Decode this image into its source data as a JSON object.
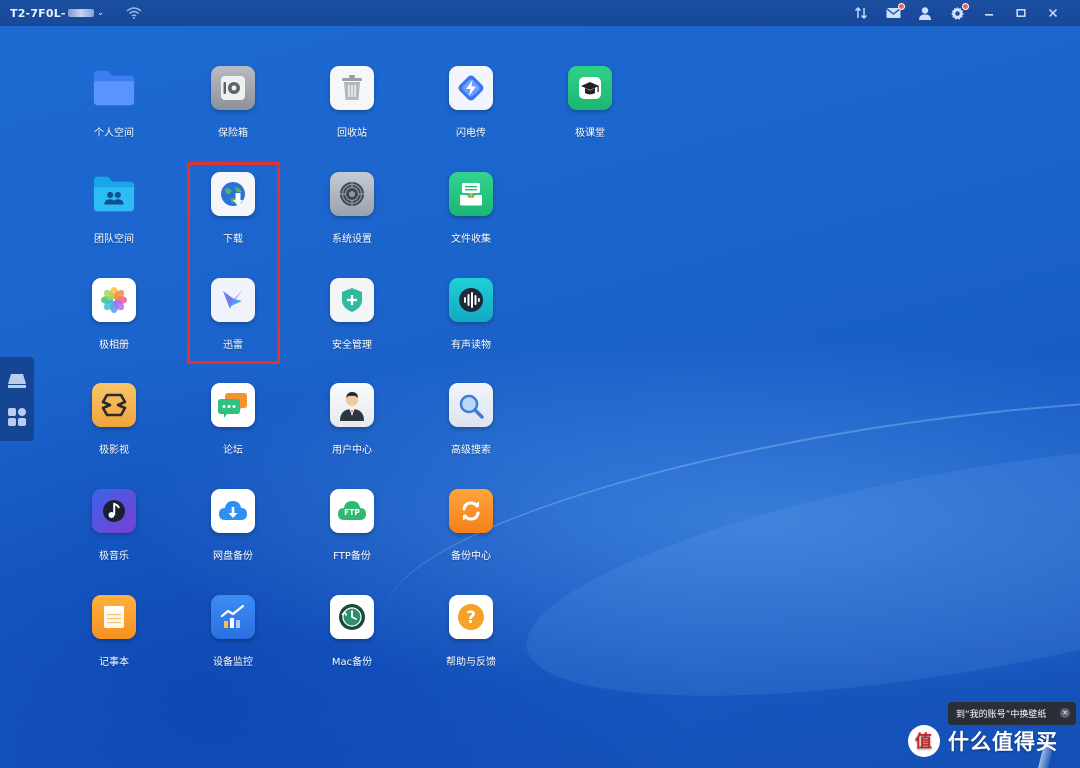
{
  "topbar": {
    "device_name": "T2-7F0L-",
    "icons": [
      "wifi-icon",
      "transfer-icon",
      "message-icon",
      "user-icon",
      "settings-icon",
      "minimize-icon",
      "maximize-icon",
      "close-icon"
    ]
  },
  "apps": [
    {
      "id": "personal-space",
      "label": "个人空间"
    },
    {
      "id": "safe-box",
      "label": "保险箱"
    },
    {
      "id": "recycle-bin",
      "label": "回收站"
    },
    {
      "id": "flash-transfer",
      "label": "闪电传"
    },
    {
      "id": "ji-course",
      "label": "极课堂"
    },
    {
      "id": "team-space",
      "label": "团队空间"
    },
    {
      "id": "download",
      "label": "下载"
    },
    {
      "id": "system-settings",
      "label": "系统设置"
    },
    {
      "id": "file-collect",
      "label": "文件收集"
    },
    {
      "id": "photo-album",
      "label": "极相册"
    },
    {
      "id": "xunlei",
      "label": "迅雷"
    },
    {
      "id": "security-management",
      "label": "安全管理"
    },
    {
      "id": "audiobook",
      "label": "有声读物"
    },
    {
      "id": "ji-video",
      "label": "极影视"
    },
    {
      "id": "forum",
      "label": "论坛"
    },
    {
      "id": "user-center",
      "label": "用户中心"
    },
    {
      "id": "advanced-search",
      "label": "高级搜索"
    },
    {
      "id": "ji-music",
      "label": "极音乐"
    },
    {
      "id": "cloud-backup",
      "label": "网盘备份"
    },
    {
      "id": "ftp-backup",
      "label": "FTP备份"
    },
    {
      "id": "backup-center",
      "label": "备份中心"
    },
    {
      "id": "notepad",
      "label": "记事本"
    },
    {
      "id": "device-monitor",
      "label": "设备监控"
    },
    {
      "id": "mac-backup",
      "label": "Mac备份"
    },
    {
      "id": "help-feedback",
      "label": "帮助与反馈"
    }
  ],
  "icon_texts": {
    "ftp": "FTP",
    "help": "?"
  },
  "tooltip": {
    "text": "到“我的账号”中换壁纸"
  },
  "watermark": {
    "text": "什么值得买",
    "logo_char": "值"
  },
  "colors": {
    "highlight_border": "#e53030",
    "topbar": "#1a4fa0",
    "desktop": "#1b63cb"
  }
}
